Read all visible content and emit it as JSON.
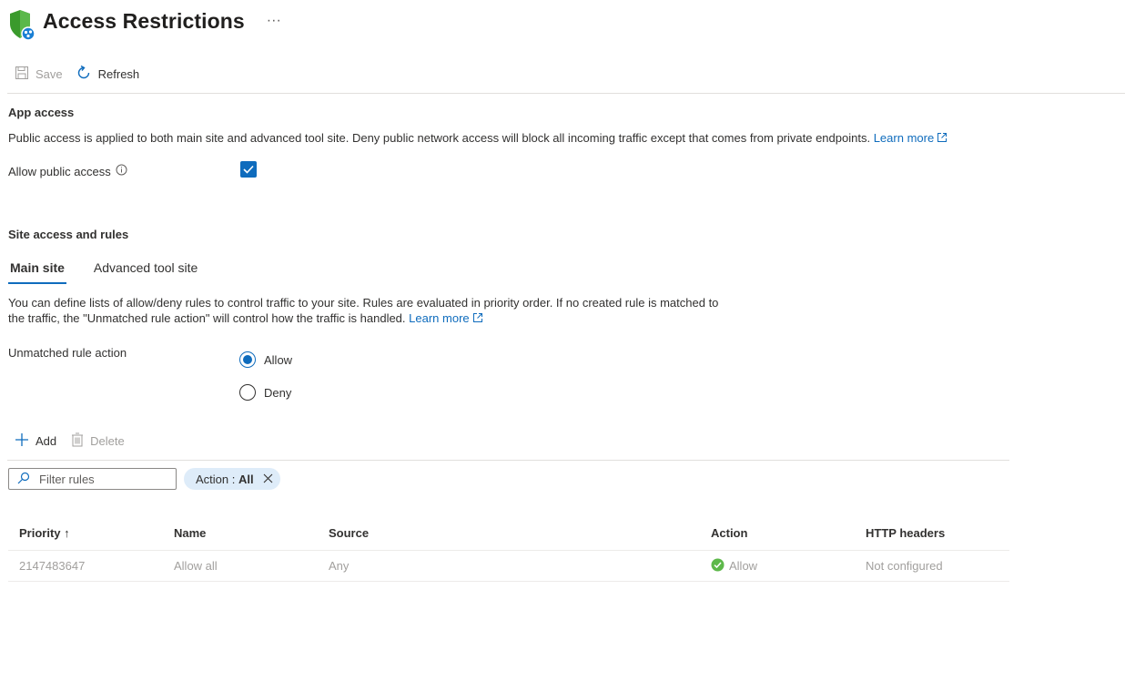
{
  "header": {
    "title": "Access Restrictions",
    "more": "···",
    "icon": "shield-network-icon"
  },
  "toolbar": {
    "save_label": "Save",
    "refresh_label": "Refresh"
  },
  "app_access": {
    "heading": "App access",
    "description": "Public access is applied to both main site and advanced tool site. Deny public network access will block all incoming traffic except that comes from private endpoints.",
    "learn_more": "Learn more",
    "allow_public_label": "Allow public access",
    "allow_public_checked": true
  },
  "site_access": {
    "heading": "Site access and rules",
    "tabs": [
      {
        "label": "Main site",
        "active": true
      },
      {
        "label": "Advanced tool site",
        "active": false
      }
    ],
    "description_line1": "You can define lists of allow/deny rules to control traffic to your site. Rules are evaluated in priority order. If no created rule is matched to",
    "description_line2": "the traffic, the \"Unmatched rule action\" will control how the traffic is handled.",
    "learn_more": "Learn more",
    "unmatched_label": "Unmatched rule action",
    "options": [
      {
        "label": "Allow",
        "selected": true
      },
      {
        "label": "Deny",
        "selected": false
      }
    ]
  },
  "rules_toolbar": {
    "add_label": "Add",
    "delete_label": "Delete"
  },
  "filter": {
    "placeholder": "Filter rules",
    "pill_key": "Action : ",
    "pill_value": "All"
  },
  "table": {
    "columns": [
      "Priority ↑",
      "Name",
      "Source",
      "Action",
      "HTTP headers"
    ],
    "rows": [
      {
        "priority": "2147483647",
        "name": "Allow all",
        "source": "Any",
        "action": "Allow",
        "http_headers": "Not configured"
      }
    ]
  },
  "colors": {
    "accent": "#0f6cbd",
    "success": "#5db84a",
    "shield": "#3a9a2c"
  }
}
